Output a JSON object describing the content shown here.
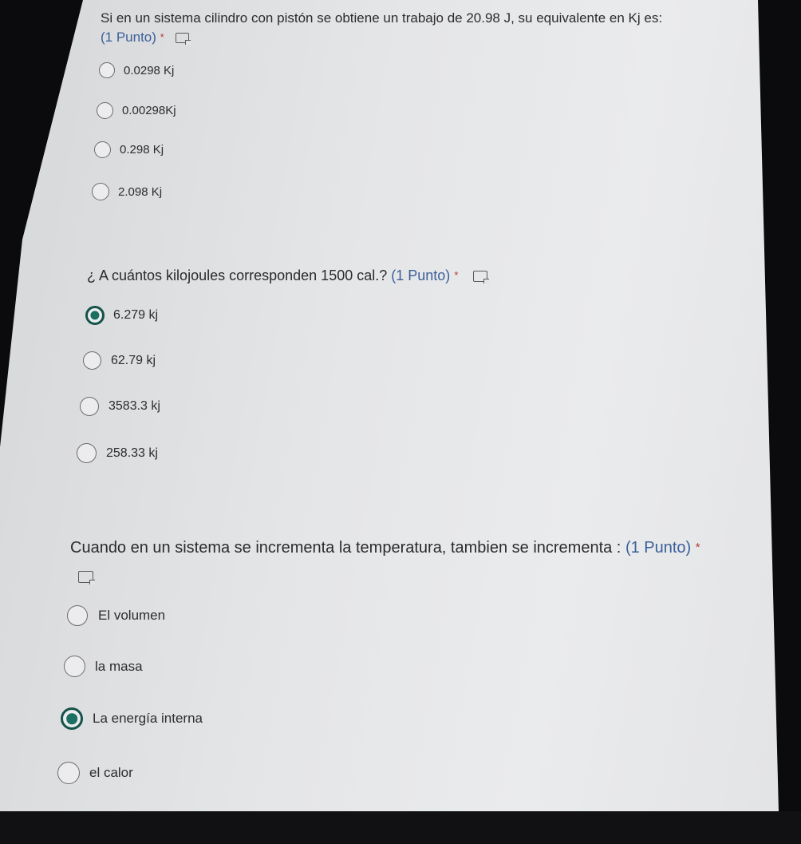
{
  "questions": [
    {
      "title": "Si en un sistema cilindro con pistón se obtiene un trabajo de  20.98 J, su equivalente en Kj es:",
      "points": "(1 Punto)",
      "required_mark": "*",
      "icon": "immersive-reader-icon",
      "options": [
        {
          "label": "0.0298 Kj",
          "selected": false
        },
        {
          "label": "0.00298Kj",
          "selected": false
        },
        {
          "label": "0.298 Kj",
          "selected": false
        },
        {
          "label": "2.098 Kj",
          "selected": false
        }
      ]
    },
    {
      "title": "¿ A cuántos kilojoules corresponden 1500 cal.?",
      "points": "(1 Punto)",
      "required_mark": "*",
      "icon": "immersive-reader-icon",
      "options": [
        {
          "label": "6.279 kj",
          "selected": true
        },
        {
          "label": "62.79 kj",
          "selected": false
        },
        {
          "label": "3583.3 kj",
          "selected": false
        },
        {
          "label": "258.33 kj",
          "selected": false
        }
      ]
    },
    {
      "title": "Cuando en un sistema se incrementa la temperatura, tambien se incrementa :",
      "points": "(1 Punto)",
      "required_mark": "*",
      "icon": "immersive-reader-icon",
      "options": [
        {
          "label": "El volumen",
          "selected": false
        },
        {
          "label": "la masa",
          "selected": false
        },
        {
          "label": "La energía interna",
          "selected": true
        },
        {
          "label": "el calor",
          "selected": false
        }
      ]
    }
  ],
  "colors": {
    "selected_radio": "#1b6f63",
    "points_text": "#3a5f9a",
    "required_mark": "#b23a3a"
  }
}
